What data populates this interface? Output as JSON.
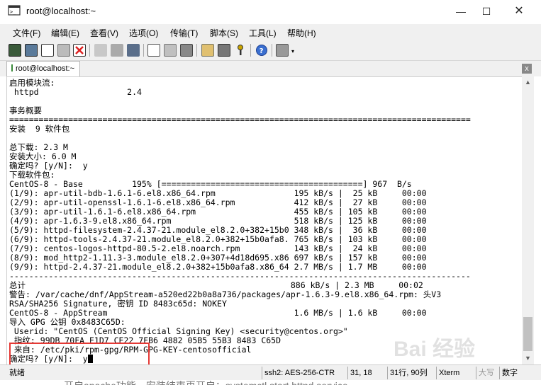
{
  "window": {
    "title": "root@localhost:~",
    "minimize_glyph": "—",
    "maximize_glyph": "☐",
    "close_glyph": "✕"
  },
  "menu": [
    "文件(F)",
    "编辑(E)",
    "查看(V)",
    "选项(O)",
    "传输(T)",
    "脚本(S)",
    "工具(L)",
    "帮助(H)"
  ],
  "toolbar": {
    "icons": [
      "new-session-icon",
      "open-session-icon",
      "reconnect-icon",
      "disconnect-icon",
      "disconnect-all-icon",
      "copy-icon",
      "paste-icon",
      "find-icon",
      "print-setup-icon",
      "print-icon",
      "log-icon",
      "session-options-icon",
      "global-options-icon",
      "key-icon",
      "help-icon",
      "screen-icon"
    ]
  },
  "tab": {
    "label": "root@localhost:~",
    "close_glyph": "x"
  },
  "terminal": {
    "lines": [
      "启用模块流:",
      " httpd                  2.4",
      "",
      "事务概要",
      "==============================================================================================",
      "安装  9 软件包",
      "",
      "总下载: 2.3 M",
      "安装大小: 6.0 M",
      "确定吗? [y/N]:  y",
      "下载软件包:",
      "CentOS-8 - Base          195% [=========================================] 967  B/s",
      "(1/9): apr-util-bdb-1.6.1-6.el8.x86_64.rpm                195 kB/s |  25 kB     00:00",
      "(2/9): apr-util-openssl-1.6.1-6.el8.x86_64.rpm            412 kB/s |  27 kB     00:00",
      "(3/9): apr-util-1.6.1-6.el8.x86_64.rpm                    455 kB/s | 105 kB     00:00",
      "(4/9): apr-1.6.3-9.el8.x86_64.rpm                         518 kB/s | 125 kB     00:00",
      "(5/9): httpd-filesystem-2.4.37-21.module_el8.2.0+382+15b0 348 kB/s |  36 kB     00:00",
      "(6/9): httpd-tools-2.4.37-21.module_el8.2.0+382+15b0afa8. 765 kB/s | 103 kB     00:00",
      "(7/9): centos-logos-httpd-80.5-2.el8.noarch.rpm           143 kB/s |  24 kB     00:00",
      "(8/9): mod_http2-1.11.3-3.module_el8.2.0+307+4d18d695.x86 697 kB/s | 157 kB     00:00",
      "(9/9): httpd-2.4.37-21.module_el8.2.0+382+15b0afa8.x86_64 2.7 MB/s | 1.7 MB     00:00",
      "----------------------------------------------------------------------------------------------",
      "总计                                                      886 kB/s | 2.3 MB     00:02",
      "警告: /var/cache/dnf/AppStream-a520ed22b0a8a736/packages/apr-1.6.3-9.el8.x86_64.rpm: 头V3",
      "RSA/SHA256 Signature, 密钥 ID 8483c65d: NOKEY",
      "CentOS-8 - AppStream                                      1.6 MB/s | 1.6 kB     00:00",
      "导入 GPG 公钥 0x8483C65D:",
      " Userid: \"CentOS (CentOS Official Signing Key) <security@centos.org>\"",
      " 指纹: 99DB 70FA E1D7 CE22 7FB6 4882 05B5 55B3 8483 C65D",
      " 来自: /etc/pki/rpm-gpg/RPM-GPG-KEY-centosofficial"
    ],
    "prompt_line": "确定吗? [y/N]:  y"
  },
  "status": {
    "ready": "就绪",
    "connection": "ssh2: AES-256-CTR",
    "cursor_pos": "31,  18",
    "size": "31行, 90列",
    "term_type": "Xterm",
    "caps": "大写",
    "num": "数字"
  },
  "watermark": "Bai 经验",
  "caption": "开启apache功能，安装结束再开启：systemctl start httpd.service"
}
